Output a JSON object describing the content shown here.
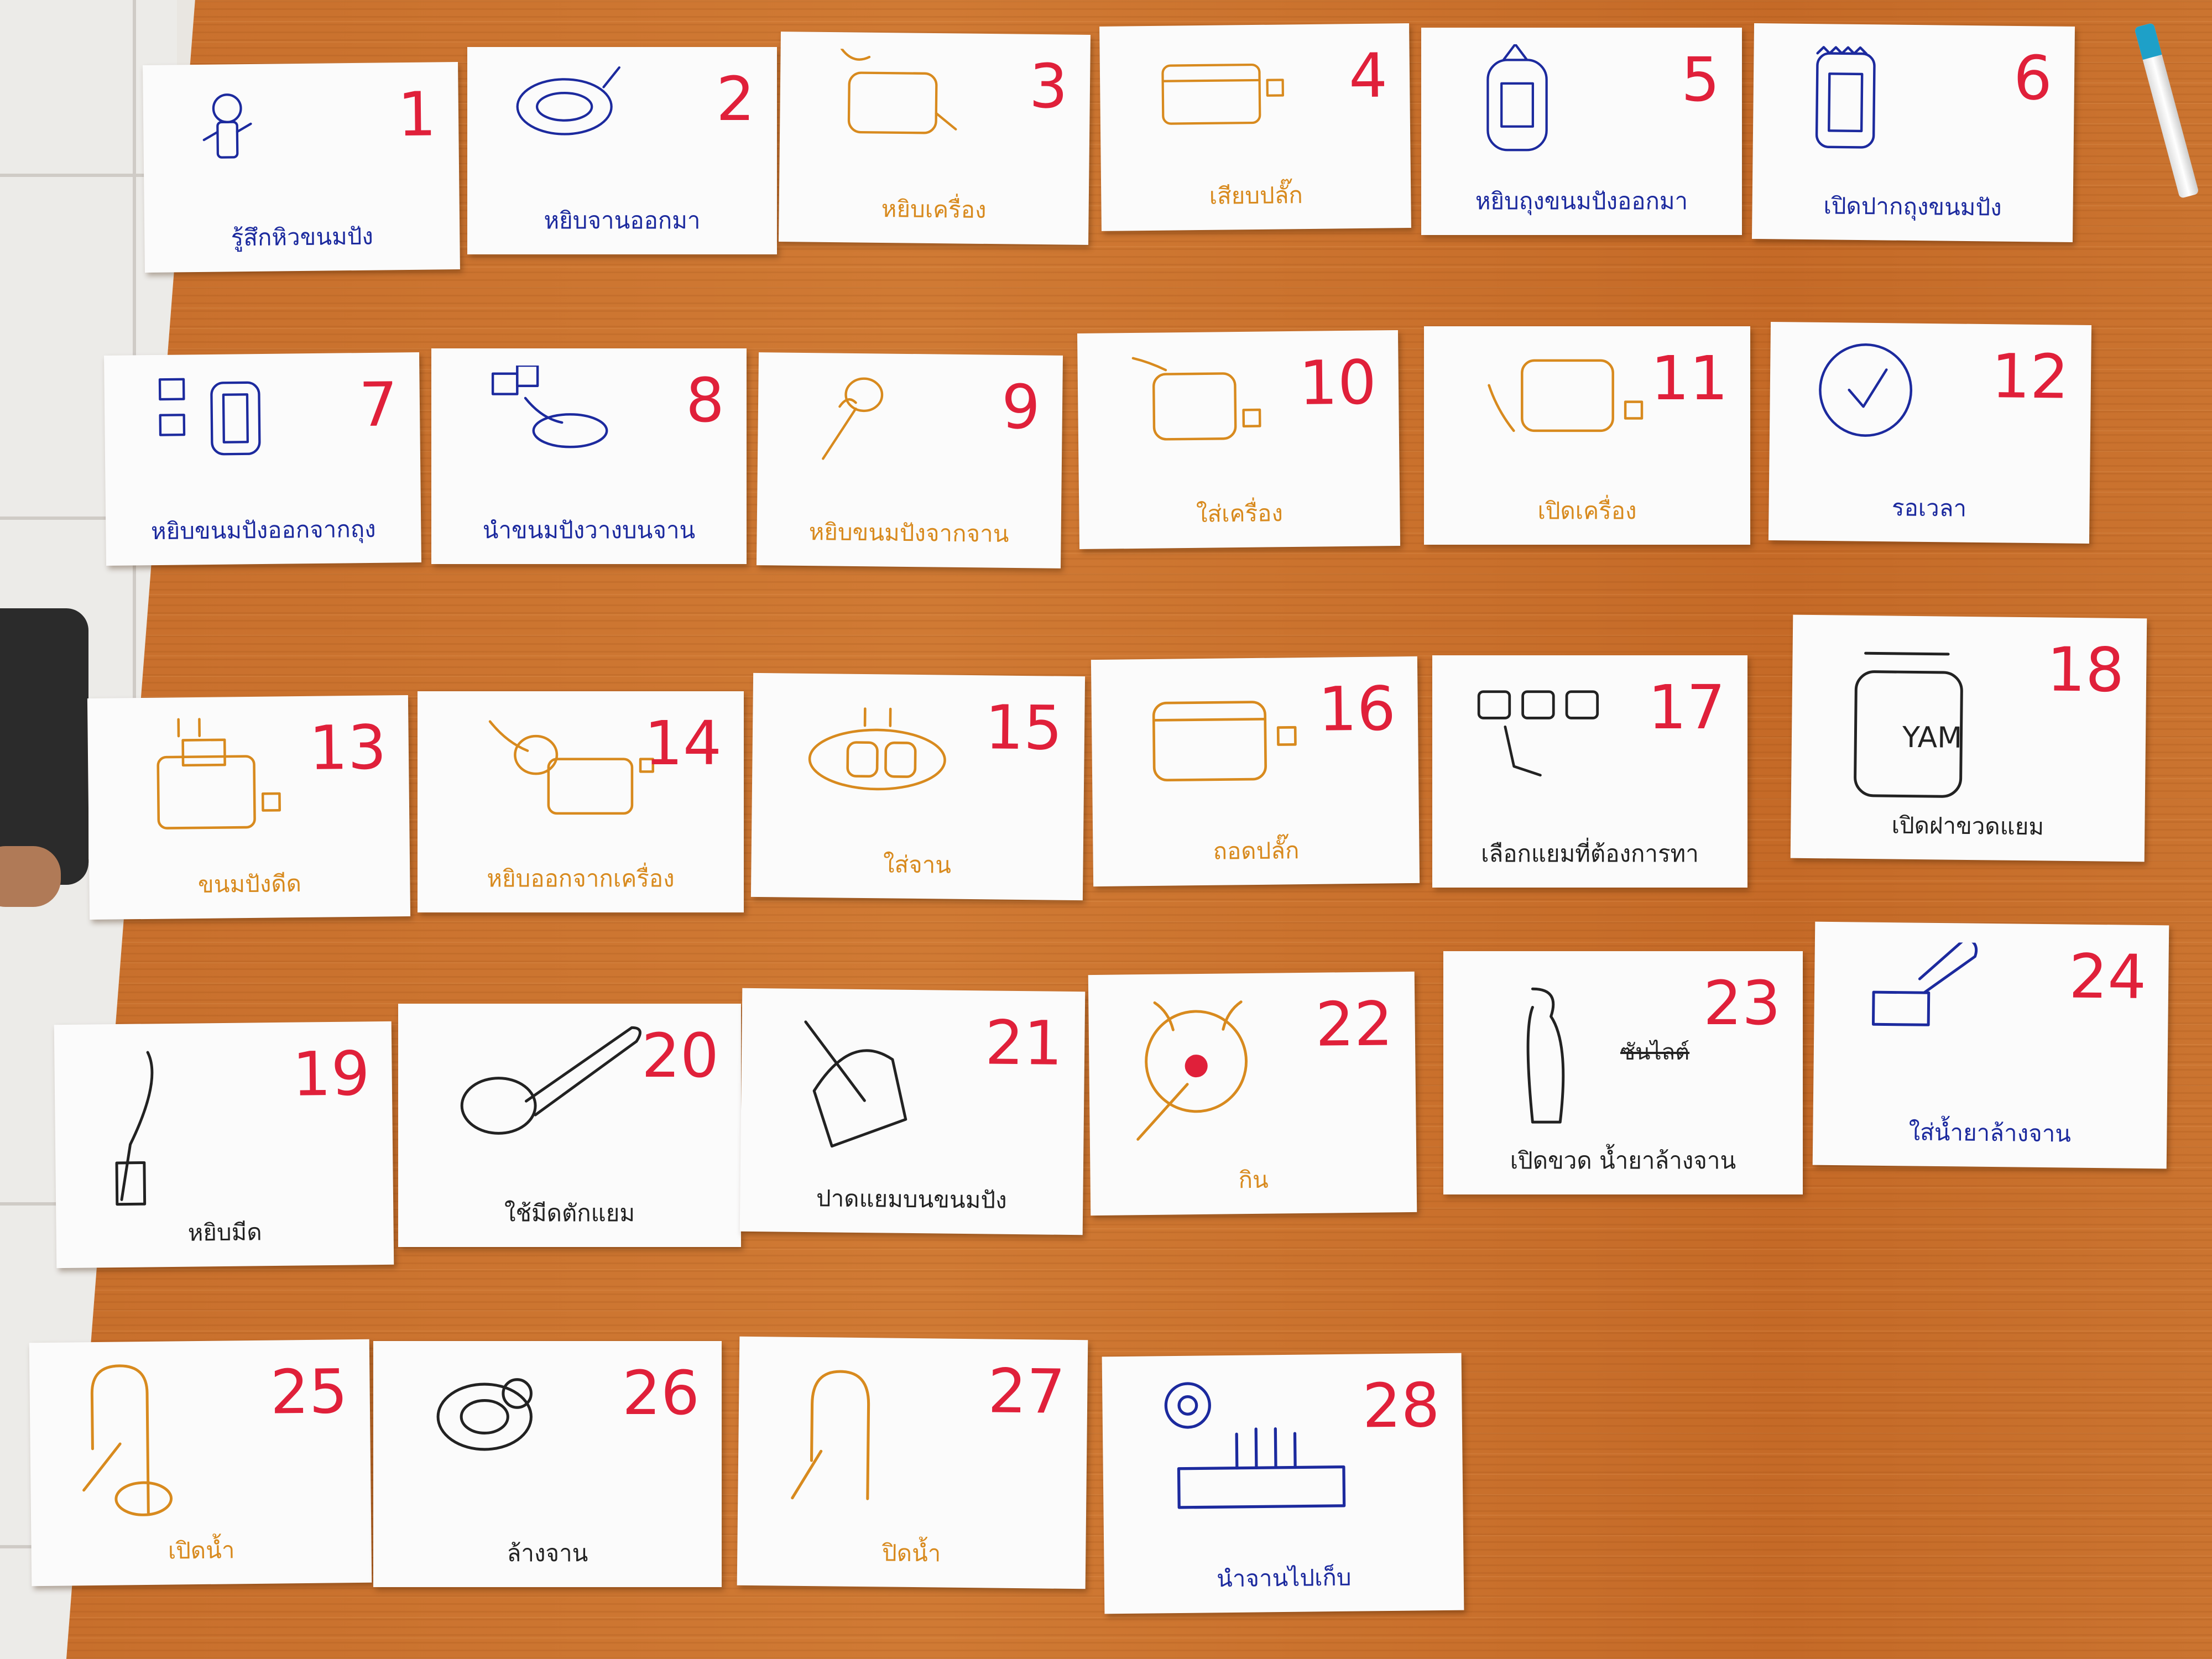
{
  "cards": [
    {
      "num": "1",
      "caption": "รู้สึกหิวขนมปัง",
      "color": "blue"
    },
    {
      "num": "2",
      "caption": "หยิบจานออกมา",
      "color": "blue"
    },
    {
      "num": "3",
      "caption": "หยิบเครื่อง",
      "color": "orange"
    },
    {
      "num": "4",
      "caption": "เสียบปลั๊ก",
      "color": "orange"
    },
    {
      "num": "5",
      "caption": "หยิบถุงขนมปังออกมา",
      "color": "blue"
    },
    {
      "num": "6",
      "caption": "เปิดปากถุงขนมปัง",
      "color": "blue"
    },
    {
      "num": "7",
      "caption": "หยิบขนมปังออกจากถุง",
      "color": "blue"
    },
    {
      "num": "8",
      "caption": "นำขนมปังวางบนจาน",
      "color": "blue"
    },
    {
      "num": "9",
      "caption": "หยิบขนมปังจากจาน",
      "color": "orange"
    },
    {
      "num": "10",
      "caption": "ใส่เครื่อง",
      "color": "orange"
    },
    {
      "num": "11",
      "caption": "เปิดเครื่อง",
      "color": "orange"
    },
    {
      "num": "12",
      "caption": "รอเวลา",
      "color": "blue"
    },
    {
      "num": "13",
      "caption": "ขนมปังดีด",
      "color": "orange"
    },
    {
      "num": "14",
      "caption": "หยิบออกจากเครื่อง",
      "color": "orange"
    },
    {
      "num": "15",
      "caption": "ใส่จาน",
      "color": "orange"
    },
    {
      "num": "16",
      "caption": "ถอดปลั๊ก",
      "color": "orange"
    },
    {
      "num": "17",
      "caption": "เลือกแยมที่ต้องการทา",
      "color": "black"
    },
    {
      "num": "18",
      "caption": "เปิดฝาขวดแยม",
      "color": "black",
      "label": "YAM"
    },
    {
      "num": "19",
      "caption": "หยิบมีด",
      "color": "black"
    },
    {
      "num": "20",
      "caption": "ใช้มีดตักแยม",
      "color": "black"
    },
    {
      "num": "21",
      "caption": "ปาดแยมบนขนมปัง",
      "color": "black"
    },
    {
      "num": "22",
      "caption": "กิน",
      "color": "orange"
    },
    {
      "num": "23",
      "caption": "เปิดขวด น้ำยาล้างจาน",
      "color": "black",
      "struck": "ซันไลต์"
    },
    {
      "num": "24",
      "caption": "ใส่น้ำยาล้างจาน",
      "color": "blue"
    },
    {
      "num": "25",
      "caption": "เปิดน้ำ",
      "color": "orange"
    },
    {
      "num": "26",
      "caption": "ล้างจาน",
      "color": "black"
    },
    {
      "num": "27",
      "caption": "ปิดน้ำ",
      "color": "orange"
    },
    {
      "num": "28",
      "caption": "นำจานไปเก็บ",
      "color": "blue"
    }
  ]
}
